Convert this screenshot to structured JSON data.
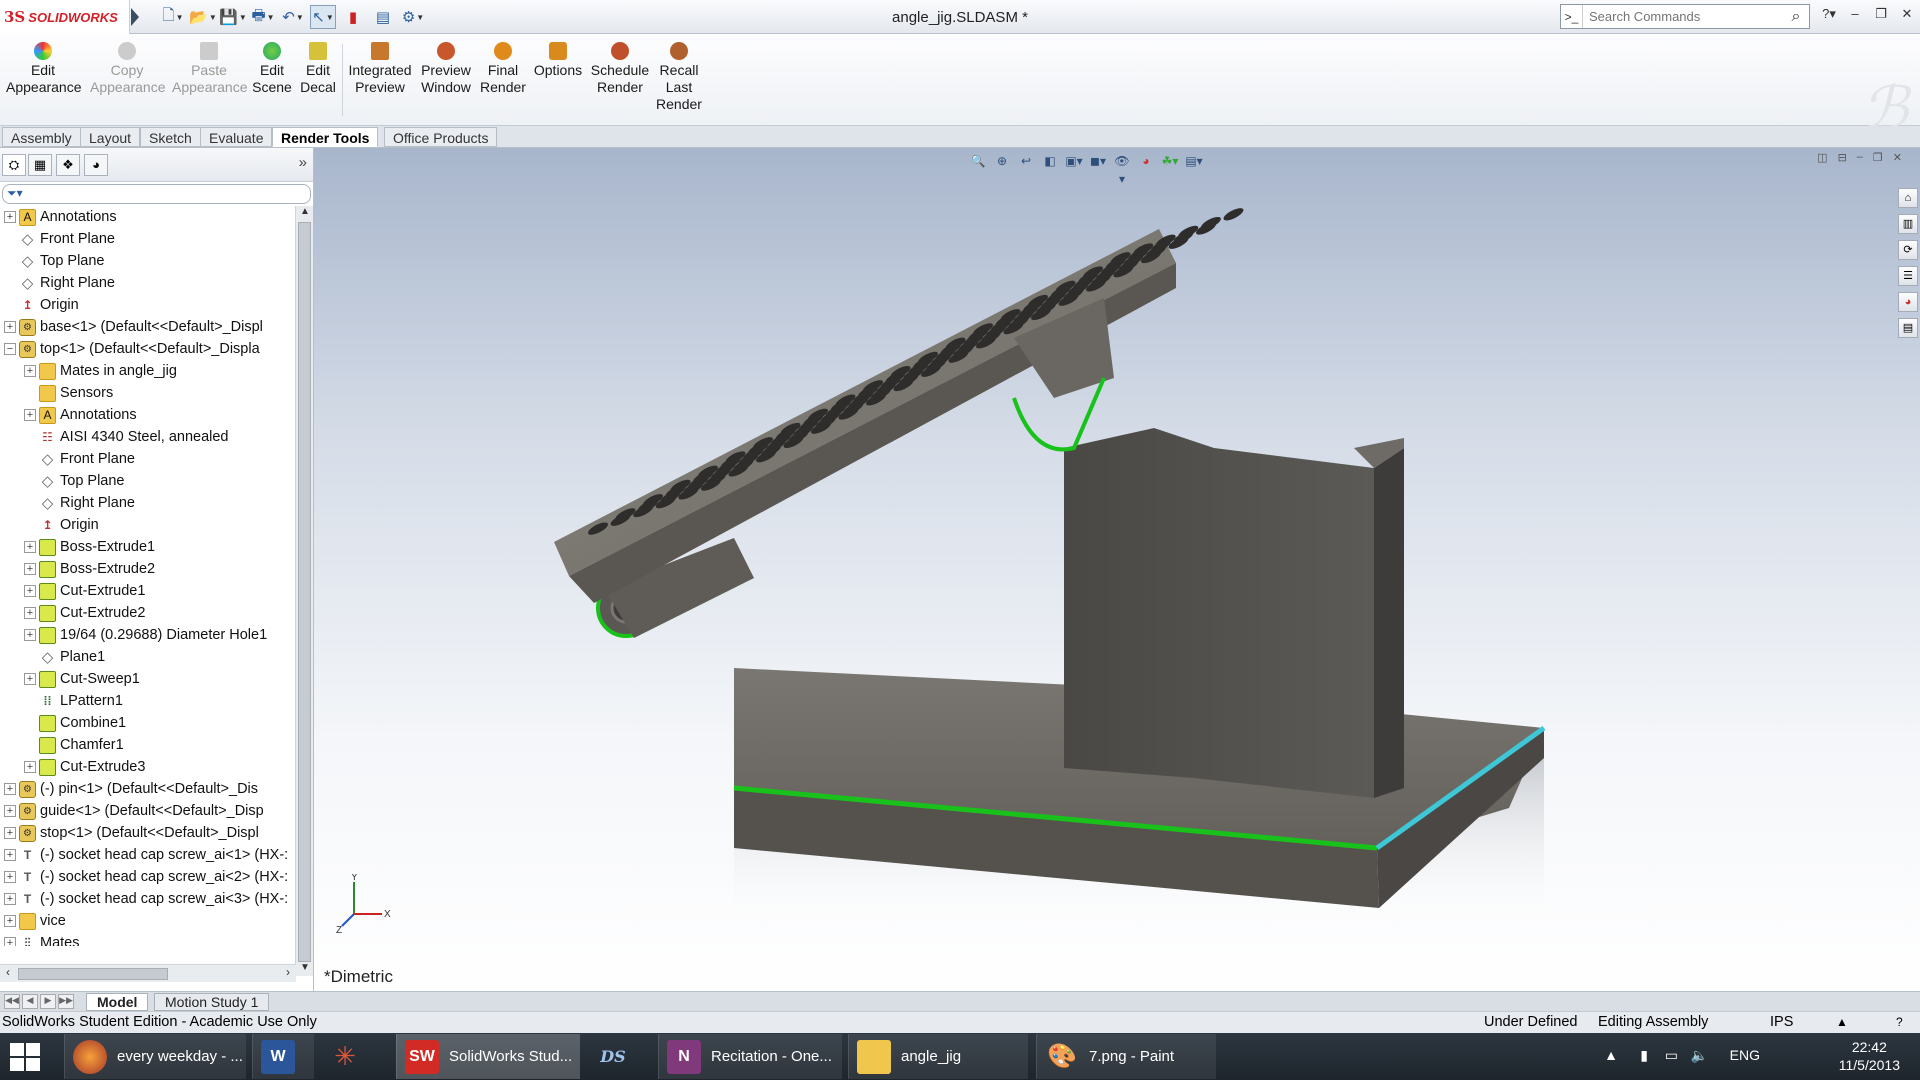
{
  "app": {
    "brand": "SOLIDWORKS",
    "brand_mark": "3S",
    "title": "angle_jig.SLDASM *"
  },
  "search": {
    "placeholder": "Search Commands"
  },
  "ribbon": {
    "buttons": [
      {
        "label": "Edit Appearance",
        "icon": "appearance-icon",
        "enabled": true
      },
      {
        "label": "Copy Appearance",
        "icon": "copy-appearance-icon",
        "enabled": false
      },
      {
        "label": "Paste Appearance",
        "icon": "paste-appearance-icon",
        "enabled": false
      },
      {
        "label": "Edit Scene",
        "icon": "scene-icon",
        "enabled": true
      },
      {
        "label": "Edit Decal",
        "icon": "decal-icon",
        "enabled": true
      },
      {
        "label": "Integrated Preview",
        "icon": "integrated-preview-icon",
        "enabled": true
      },
      {
        "label": "Preview Window",
        "icon": "preview-window-icon",
        "enabled": true
      },
      {
        "label": "Final Render",
        "icon": "final-render-icon",
        "enabled": true
      },
      {
        "label": "Options",
        "icon": "options-icon",
        "enabled": true
      },
      {
        "label": "Schedule Render",
        "icon": "schedule-render-icon",
        "enabled": true
      },
      {
        "label": "Recall Last Render",
        "icon": "recall-render-icon",
        "enabled": true
      }
    ]
  },
  "command_tabs": [
    "Assembly",
    "Layout",
    "Sketch",
    "Evaluate",
    "Render Tools",
    "Office Products"
  ],
  "active_command_tab": "Render Tools",
  "feature_tree": [
    {
      "label": "Annotations",
      "indent": 0,
      "icon": "annotations-icon",
      "expandable": true
    },
    {
      "label": "Front Plane",
      "indent": 0,
      "icon": "plane-icon",
      "expandable": false
    },
    {
      "label": "Top Plane",
      "indent": 0,
      "icon": "plane-icon",
      "expandable": false
    },
    {
      "label": "Right Plane",
      "indent": 0,
      "icon": "plane-icon",
      "expandable": false
    },
    {
      "label": "Origin",
      "indent": 0,
      "icon": "origin-icon",
      "expandable": false
    },
    {
      "label": "base<1> (Default<<Default>_Displ",
      "indent": 0,
      "icon": "part-icon",
      "expandable": true
    },
    {
      "label": "top<1> (Default<<Default>_Displa",
      "indent": 0,
      "icon": "part-icon",
      "expandable": true,
      "expanded": true
    },
    {
      "label": "Mates in angle_jig",
      "indent": 1,
      "icon": "mates-folder-icon",
      "expandable": true
    },
    {
      "label": "Sensors",
      "indent": 1,
      "icon": "sensors-icon",
      "expandable": false
    },
    {
      "label": "Annotations",
      "indent": 1,
      "icon": "annotations-icon",
      "expandable": true
    },
    {
      "label": "AISI 4340 Steel, annealed",
      "indent": 1,
      "icon": "material-icon",
      "expandable": false
    },
    {
      "label": "Front Plane",
      "indent": 1,
      "icon": "plane-icon",
      "expandable": false
    },
    {
      "label": "Top Plane",
      "indent": 1,
      "icon": "plane-icon",
      "expandable": false
    },
    {
      "label": "Right Plane",
      "indent": 1,
      "icon": "plane-icon",
      "expandable": false
    },
    {
      "label": "Origin",
      "indent": 1,
      "icon": "origin-icon",
      "expandable": false
    },
    {
      "label": "Boss-Extrude1",
      "indent": 1,
      "icon": "extrude-icon",
      "expandable": true
    },
    {
      "label": "Boss-Extrude2",
      "indent": 1,
      "icon": "extrude-icon",
      "expandable": true
    },
    {
      "label": "Cut-Extrude1",
      "indent": 1,
      "icon": "cut-extrude-icon",
      "expandable": true
    },
    {
      "label": "Cut-Extrude2",
      "indent": 1,
      "icon": "cut-extrude-icon",
      "expandable": true
    },
    {
      "label": "19/64 (0.29688) Diameter Hole1",
      "indent": 1,
      "icon": "hole-icon",
      "expandable": true
    },
    {
      "label": "Plane1",
      "indent": 1,
      "icon": "plane-icon",
      "expandable": false
    },
    {
      "label": "Cut-Sweep1",
      "indent": 1,
      "icon": "sweep-icon",
      "expandable": true
    },
    {
      "label": "LPattern1",
      "indent": 1,
      "icon": "pattern-icon",
      "expandable": false
    },
    {
      "label": "Combine1",
      "indent": 1,
      "icon": "combine-icon",
      "expandable": false
    },
    {
      "label": "Chamfer1",
      "indent": 1,
      "icon": "chamfer-icon",
      "expandable": false
    },
    {
      "label": "Cut-Extrude3",
      "indent": 1,
      "icon": "cut-extrude-icon",
      "expandable": true
    },
    {
      "label": "(-) pin<1> (Default<<Default>_Dis",
      "indent": 0,
      "icon": "part-icon",
      "expandable": true
    },
    {
      "label": "guide<1> (Default<<Default>_Disp",
      "indent": 0,
      "icon": "part-icon",
      "expandable": true
    },
    {
      "label": "stop<1> (Default<<Default>_Displ",
      "indent": 0,
      "icon": "part-icon",
      "expandable": true
    },
    {
      "label": "(-) socket head cap screw_ai<1> (HX-:",
      "indent": 0,
      "icon": "screw-icon",
      "expandable": true
    },
    {
      "label": "(-) socket head cap screw_ai<2> (HX-:",
      "indent": 0,
      "icon": "screw-icon",
      "expandable": true
    },
    {
      "label": "(-) socket head cap screw_ai<3> (HX-:",
      "indent": 0,
      "icon": "screw-icon",
      "expandable": true
    },
    {
      "label": "vice",
      "indent": 0,
      "icon": "folder-icon",
      "expandable": true
    },
    {
      "label": "Mates",
      "indent": 0,
      "icon": "mates-icon",
      "expandable": true
    }
  ],
  "viewport": {
    "view_label": "*Dimetric",
    "triad": {
      "x": "X",
      "y": "Y",
      "z": "Z"
    }
  },
  "bottom_tabs": [
    "Model",
    "Motion Study 1"
  ],
  "active_bottom_tab": "Model",
  "status": {
    "left": "SolidWorks Student Edition - Academic Use Only",
    "define_state": "Under Defined",
    "mode": "Editing Assembly",
    "units": "IPS",
    "help": "?"
  },
  "taskbar": {
    "items": [
      {
        "label": "every weekday - ...",
        "icon": "firefox-icon"
      },
      {
        "label": "",
        "icon": "word-icon"
      },
      {
        "label": "",
        "icon": "app-star-icon"
      },
      {
        "label": "SolidWorks Stud...",
        "icon": "solidworks-icon"
      },
      {
        "label": "",
        "icon": "ds-app-icon"
      },
      {
        "label": "Recitation - One...",
        "icon": "onenote-icon"
      },
      {
        "label": "angle_jig",
        "icon": "folder-icon"
      },
      {
        "label": "7.png - Paint",
        "icon": "paint-icon"
      }
    ],
    "language": "ENG",
    "time": "22:42",
    "date": "11/5/2013"
  }
}
